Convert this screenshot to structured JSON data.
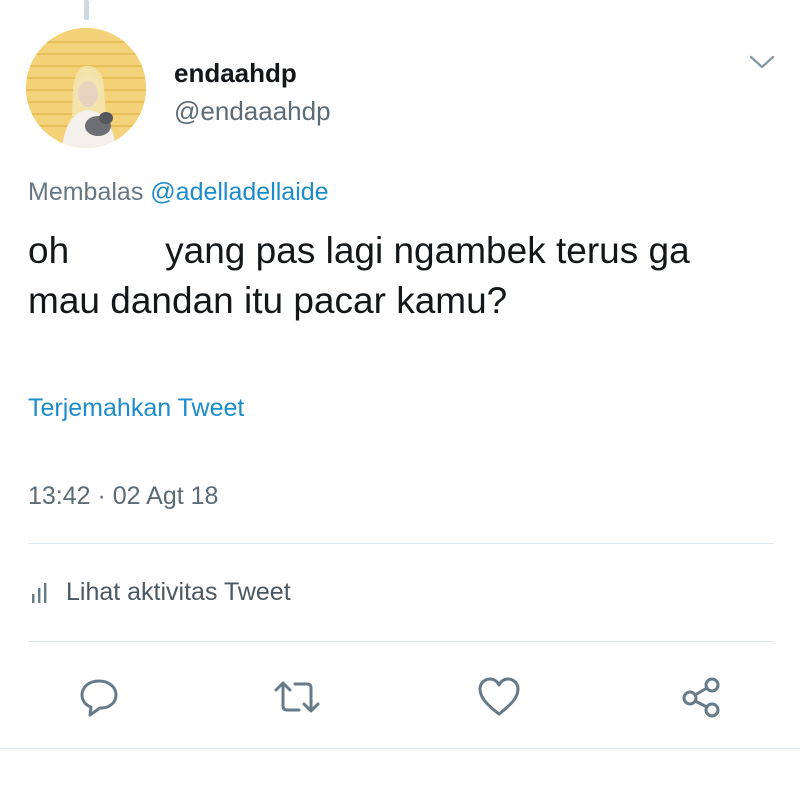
{
  "tweet": {
    "display_name": "endaahdp",
    "handle": "@endaaahdp",
    "reply_prefix": "Membalas",
    "reply_to": "@adelladellaide",
    "text_part1": "oh",
    "text_part2": "yang pas lagi ngambek terus ga",
    "text_line2": "mau dandan itu pacar kamu?",
    "translate_label": "Terjemahkan Tweet",
    "timestamp": "13:42 · 02 Agt 18",
    "activity_label": "Lihat aktivitas Tweet"
  },
  "actions": [
    "reply-icon",
    "retweet-icon",
    "like-icon",
    "share-icon"
  ],
  "colors": {
    "link": "#1b8ccc",
    "text": "#14171a",
    "secondary": "#5b6b77",
    "icon": "#667a8a",
    "divider": "#e1e8ed"
  }
}
